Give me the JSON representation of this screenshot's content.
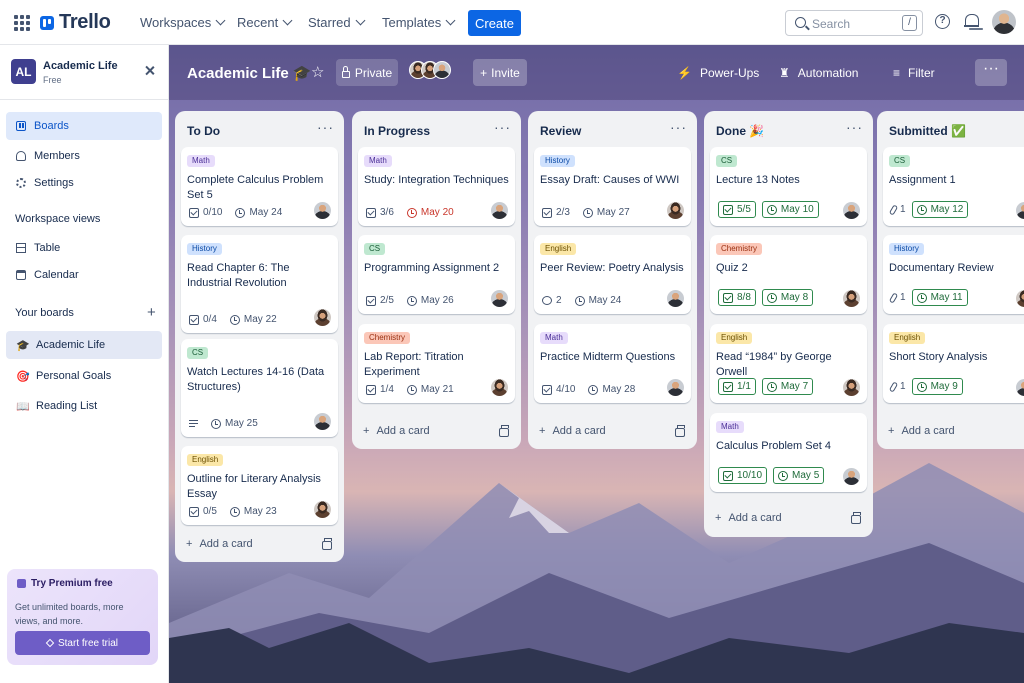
{
  "topbar": {
    "logo_text": "Trello",
    "nav": [
      {
        "label": "Workspaces"
      },
      {
        "label": "Recent"
      },
      {
        "label": "Starred"
      },
      {
        "label": "Templates"
      }
    ],
    "create_label": "Create",
    "search_placeholder": "Search",
    "search_shortcut": "/",
    "help_glyph": "?"
  },
  "sidebar": {
    "workspace_initials": "AL",
    "workspace_name": "Academic Life",
    "workspace_plan": "Free",
    "items": [
      {
        "label": "Boards",
        "icon": "board-icon"
      },
      {
        "label": "Members",
        "icon": "members-icon"
      },
      {
        "label": "Settings",
        "icon": "settings-icon"
      }
    ],
    "views_heading": "Workspace views",
    "views": [
      {
        "label": "Table",
        "icon": "table-icon"
      },
      {
        "label": "Calendar",
        "icon": "calendar-icon"
      }
    ],
    "boards_heading": "Your boards",
    "add_board": "+",
    "boards": [
      {
        "label": "Academic Life",
        "emoji": "🎓"
      },
      {
        "label": "Personal Goals",
        "emoji": "🎯"
      },
      {
        "label": "Reading List",
        "emoji": "📖"
      }
    ],
    "premium": {
      "title": "Try Premium free",
      "desc": "Get unlimited boards, more views, and more.",
      "button": "Start free trial"
    }
  },
  "board": {
    "title": "Academic Life",
    "title_emoji": "🎓",
    "star": "☆",
    "visibility": "Private",
    "invite": "Invite",
    "powerups": "Power-Ups",
    "automation": "Automation",
    "filter": "Filter",
    "more": "···",
    "add_card_label": "Add a card",
    "add_card_plus": "+",
    "list_more": "···"
  },
  "lists": [
    {
      "title": "To Do",
      "cards": [
        {
          "label": "Math",
          "title": "Complete Calculus Problem Set 5",
          "checklist": "0/10",
          "due": "May 24"
        },
        {
          "label": "History",
          "title": "Read Chapter 6: The Industrial Revolution",
          "checklist": "0/4",
          "due": "May 22"
        },
        {
          "label": "CS",
          "title": "Watch Lectures 14-16 (Data Structures)",
          "due": "May 25"
        },
        {
          "label": "English",
          "title": "Outline for Literary Analysis Essay",
          "checklist": "0/5",
          "due": "May 23"
        }
      ]
    },
    {
      "title": "In Progress",
      "cards": [
        {
          "label": "Math",
          "title": "Study: Integration Techniques",
          "checklist": "3/6",
          "due": "May 20",
          "due_status": "overdue"
        },
        {
          "label": "CS",
          "title": "Programming Assignment 2",
          "checklist": "2/5",
          "due": "May 26"
        },
        {
          "label": "Chemistry",
          "title": "Lab Report: Titration Experiment",
          "checklist": "1/4",
          "due": "May 21"
        }
      ]
    },
    {
      "title": "Review",
      "cards": [
        {
          "label": "History",
          "title": "Essay Draft: Causes of WWI",
          "checklist": "2/3",
          "due": "May 27"
        },
        {
          "label": "English",
          "title": "Peer Review: Poetry Analysis",
          "comments": "2",
          "due": "May 24"
        },
        {
          "label": "Math",
          "title": "Practice Midterm Questions",
          "checklist": "4/10",
          "due": "May 28"
        }
      ]
    },
    {
      "title": "Done",
      "title_emoji": "🎉",
      "cards": [
        {
          "label": "CS",
          "title": "Lecture 13 Notes",
          "checklist": "5/5",
          "due": "May 10"
        },
        {
          "label": "Chemistry",
          "title": "Quiz 2",
          "checklist": "8/8",
          "due": "May 8"
        },
        {
          "label": "English",
          "title": "Read “1984” by George Orwell",
          "checklist": "1/1",
          "due": "May 7"
        },
        {
          "label": "Math",
          "title": "Calculus Problem Set 4",
          "checklist": "10/10",
          "due": "May 5"
        }
      ]
    },
    {
      "title": "Submitted",
      "title_emoji": "✅",
      "cards": [
        {
          "label": "CS",
          "title": "Assignment 1",
          "attachments": "1",
          "due": "May 12"
        },
        {
          "label": "History",
          "title": "Documentary Review",
          "attachments": "1",
          "due": "May 11"
        },
        {
          "label": "English",
          "title": "Short Story Analysis",
          "attachments": "1",
          "due": "May 9"
        }
      ]
    }
  ],
  "colors": {
    "brand_blue": "#0c66e4",
    "premium_purple": "#6e5dc6",
    "done_green": "#2f8a4e",
    "overdue_red": "#c9372c"
  }
}
